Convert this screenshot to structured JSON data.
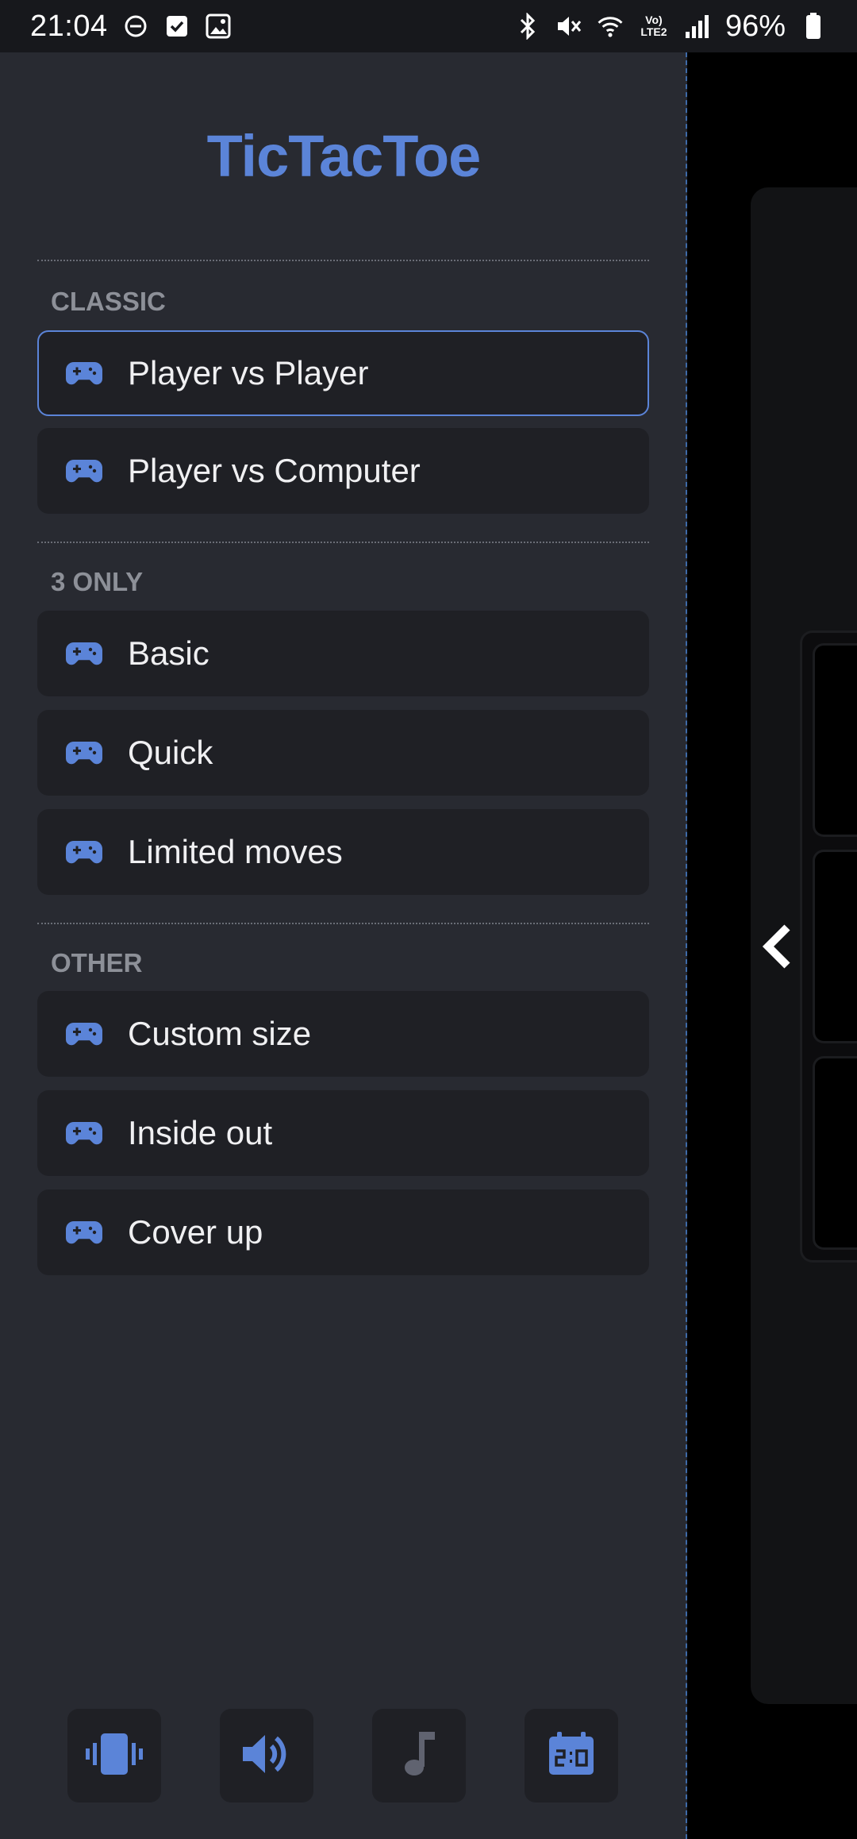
{
  "status_bar": {
    "time": "21:04",
    "battery": "96%",
    "net_label": "Vo) LTE2"
  },
  "drawer": {
    "title": "TicTacToe",
    "sections": [
      {
        "label": "CLASSIC",
        "items": [
          "Player vs Player",
          "Player vs Computer"
        ]
      },
      {
        "label": "3 ONLY",
        "items": [
          "Basic",
          "Quick",
          "Limited moves"
        ]
      },
      {
        "label": "OTHER",
        "items": [
          "Custom size",
          "Inside out",
          "Cover up"
        ]
      }
    ],
    "selected_item": "Player vs Player"
  },
  "toolbar": {
    "buttons": [
      "vibration-icon",
      "volume-icon",
      "music-note-icon",
      "scoreboard-icon"
    ],
    "music_enabled": false
  },
  "colors": {
    "accent": "#5b84d8",
    "drawer_bg": "#282a31",
    "item_bg": "#1f2025",
    "muted": "#8d9098"
  }
}
